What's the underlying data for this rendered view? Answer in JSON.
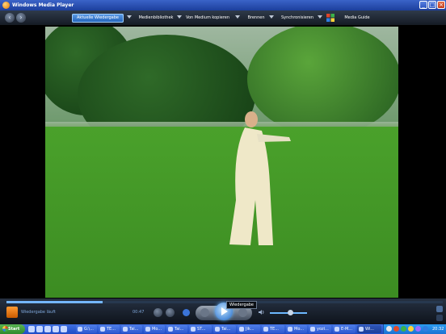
{
  "window": {
    "title": "Windows Media Player",
    "buttons": {
      "minimize": "_",
      "maximize": "□",
      "close": "×"
    }
  },
  "nav": {
    "back_icon": "back-arrow-icon",
    "forward_icon": "forward-arrow-icon",
    "tabs": [
      {
        "label": "Aktuelle Wiedergabe",
        "active": true
      },
      {
        "label": "Medienbibliothek",
        "active": false
      },
      {
        "label": "Von Medium kopieren",
        "active": false
      },
      {
        "label": "Brennen",
        "active": false
      },
      {
        "label": "Synchronisieren",
        "active": false
      },
      {
        "label": "Media Guide",
        "active": false
      }
    ]
  },
  "video": {
    "description_icon": "video-frame"
  },
  "controls": {
    "progress": 0.22,
    "now_playing_text": "Wiedergabe läuft",
    "time": "00:47",
    "tooltip": "Wiedergabe",
    "volume": 0.55
  },
  "taskbar": {
    "start_label": "Start",
    "items": [
      {
        "label": "G:\\..."
      },
      {
        "label": "TE..."
      },
      {
        "label": "Tai..."
      },
      {
        "label": "Mo..."
      },
      {
        "label": "Tai..."
      },
      {
        "label": "ST..."
      },
      {
        "label": "Tai..."
      },
      {
        "label": "Jik..."
      },
      {
        "label": "TE..."
      },
      {
        "label": "Mo..."
      },
      {
        "label": "yozi..."
      },
      {
        "label": "E-M..."
      },
      {
        "label": "Wi..."
      }
    ],
    "clock": "20:32"
  },
  "colors": {
    "titlebar": "#1d3f9c",
    "accent": "#5f9fe8",
    "taskbar": "#2e5ad2",
    "start": "#3bb24a"
  }
}
